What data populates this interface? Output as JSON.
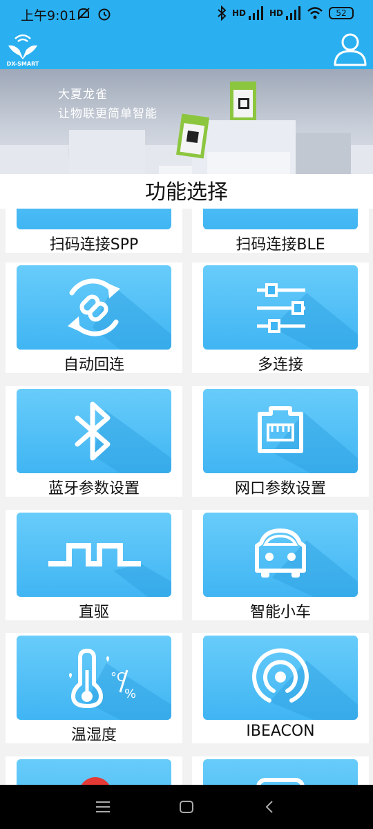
{
  "status_bar": {
    "time": "上午9:01",
    "network_label_1": "HD",
    "network_label_2": "HD",
    "battery": "52",
    "icons": [
      "mute-icon",
      "alarm-icon",
      "bluetooth-icon",
      "signal-icon",
      "wifi-icon",
      "battery-icon"
    ]
  },
  "app_bar": {
    "logo_text": "DX-SMART"
  },
  "banner": {
    "line1": "大夏龙雀",
    "line2": "让物联更简单智能"
  },
  "section": {
    "title": "功能选择"
  },
  "functions": [
    {
      "label": "扫码连接SPP",
      "icon": "qr-scan-icon"
    },
    {
      "label": "扫码连接BLE",
      "icon": "qr-scan-icon"
    },
    {
      "label": "自动回连",
      "icon": "auto-reconnect-icon"
    },
    {
      "label": "多连接",
      "icon": "sliders-icon"
    },
    {
      "label": "蓝牙参数设置",
      "icon": "bluetooth-icon"
    },
    {
      "label": "网口参数设置",
      "icon": "ethernet-port-icon"
    },
    {
      "label": "直驱",
      "icon": "square-wave-icon"
    },
    {
      "label": "智能小车",
      "icon": "car-icon"
    },
    {
      "label": "温湿度",
      "icon": "thermometer-humidity-icon"
    },
    {
      "label": "IBEACON",
      "icon": "ibeacon-icon"
    },
    {
      "label": "",
      "icon": "red-dot-icon"
    },
    {
      "label": "",
      "icon": "unknown-icon"
    }
  ],
  "thermo_text": {
    "unit_c": "°C",
    "unit_pct": "%"
  },
  "nav_bar": {
    "icons": [
      "menu-icon",
      "home-icon",
      "back-icon"
    ]
  }
}
